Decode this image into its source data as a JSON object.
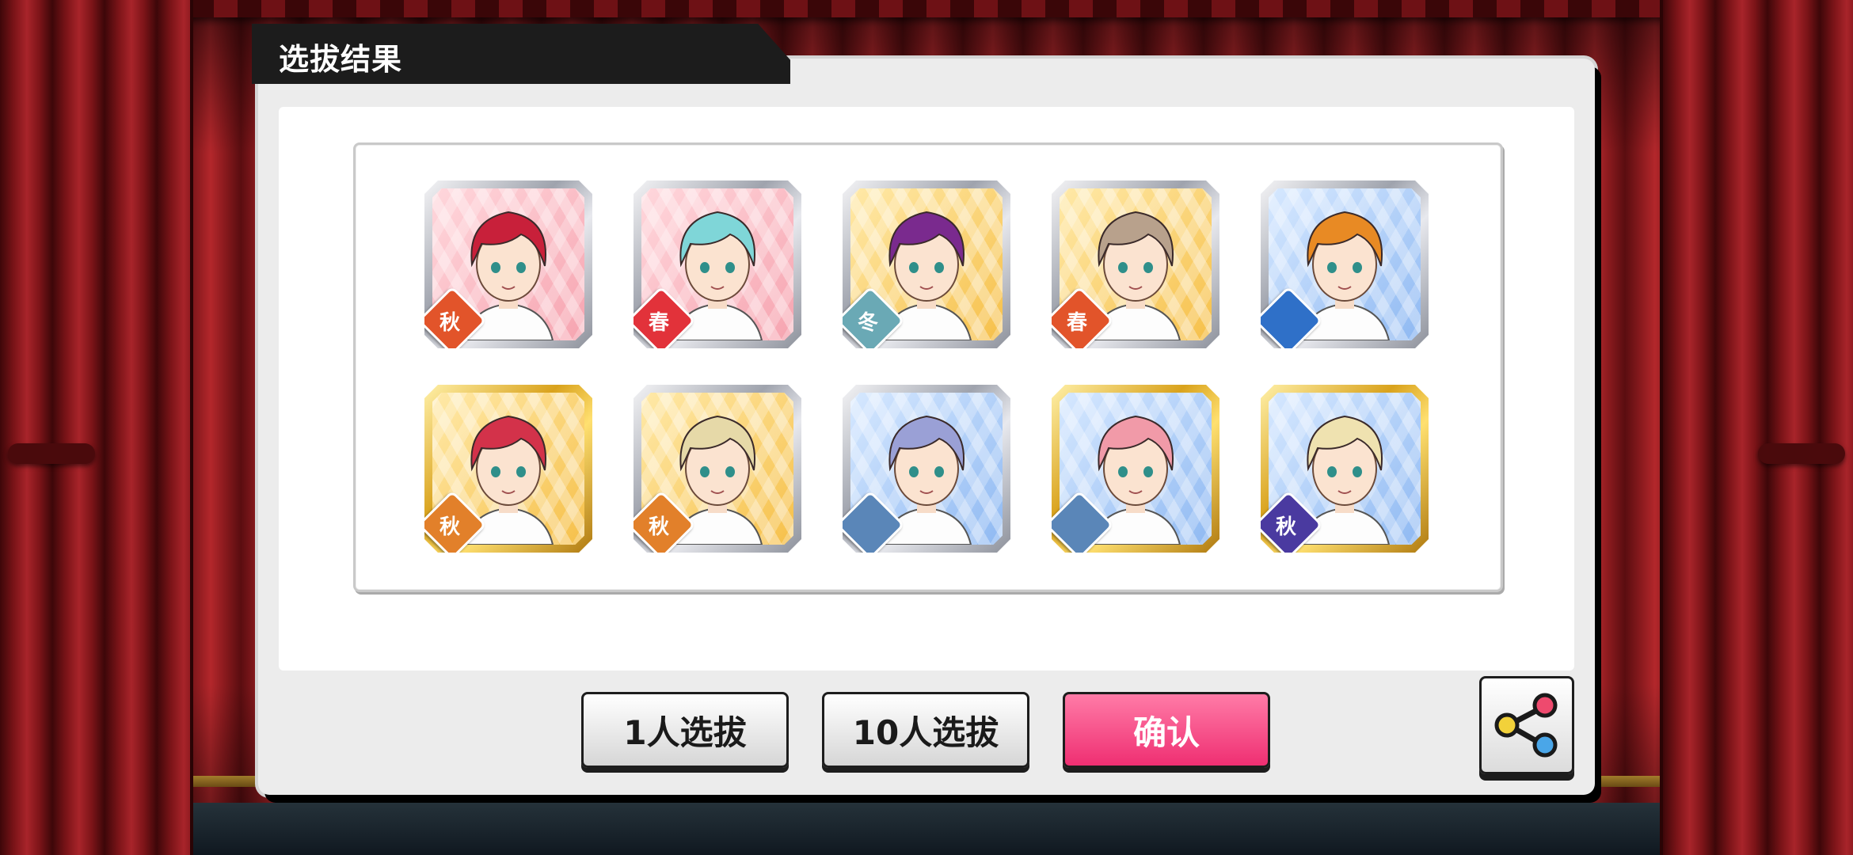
{
  "header": {
    "title": "选拔结果"
  },
  "cards": [
    {
      "frame": "silver",
      "bg": "pink",
      "hair": "#c8203a",
      "season": "秋",
      "season_color": "#e2542a"
    },
    {
      "frame": "silver",
      "bg": "pink",
      "hair": "#7fd6d8",
      "season": "春",
      "season_color": "#e2323a"
    },
    {
      "frame": "silver",
      "bg": "yellow",
      "hair": "#7a2a8e",
      "season": "冬",
      "season_color": "#6aa9b5"
    },
    {
      "frame": "silver",
      "bg": "yellow",
      "hair": "#b8a18c",
      "season": "春",
      "season_color": "#e2542a"
    },
    {
      "frame": "silver",
      "bg": "blue",
      "hair": "#e88a24",
      "season": "",
      "season_color": "#2f70c8"
    },
    {
      "frame": "gold",
      "bg": "yellow",
      "hair": "#d3324a",
      "season": "秋",
      "season_color": "#e2802a"
    },
    {
      "frame": "silver",
      "bg": "yellow",
      "hair": "#e6d9a8",
      "season": "秋",
      "season_color": "#e2802a"
    },
    {
      "frame": "silver",
      "bg": "blue",
      "hair": "#9aa0d6",
      "season": "",
      "season_color": "#5a86b8"
    },
    {
      "frame": "gold",
      "bg": "blue",
      "hair": "#f19aa8",
      "season": "",
      "season_color": "#5a86b8"
    },
    {
      "frame": "gold",
      "bg": "blue",
      "hair": "#efe2b0",
      "season": "秋",
      "season_color": "#4a3aa0"
    }
  ],
  "buttons": {
    "single": "1人选拔",
    "ten": "10人选拔",
    "confirm": "确认"
  },
  "icons": {
    "share": "share-icon"
  }
}
